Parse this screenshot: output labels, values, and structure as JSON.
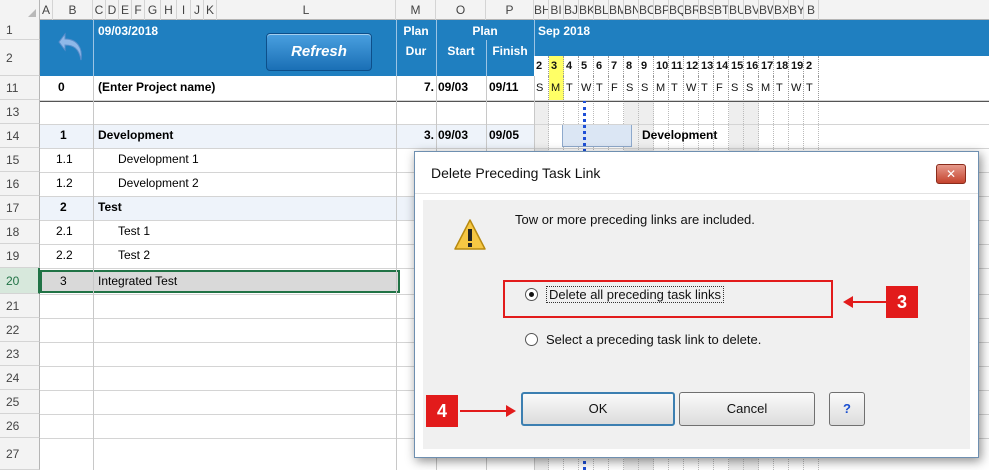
{
  "columns": [
    "A",
    "B",
    "C",
    "D",
    "E",
    "F",
    "G",
    "H",
    "I",
    "J",
    "K",
    "L",
    "M",
    "O",
    "P",
    "BH",
    "BI",
    "BJ",
    "BK",
    "BL",
    "BM",
    "BN",
    "BO",
    "BP",
    "BQ",
    "BR",
    "BS",
    "BT",
    "BU",
    "BV",
    "BW",
    "BX",
    "BY",
    "B"
  ],
  "row_numbers": [
    "1",
    "2",
    "11",
    "13",
    "14",
    "15",
    "16",
    "17",
    "18",
    "19",
    "20",
    "21",
    "22",
    "23",
    "24",
    "25",
    "26",
    "27"
  ],
  "header": {
    "date": "09/03/2018",
    "refresh_label": "Refresh",
    "plan_dur_1": "Plan",
    "plan_dur_2": "Dur",
    "plan_label": "Plan",
    "start_label": "Start",
    "finish_label": "Finish",
    "month": "Sep 2018",
    "days": [
      "2",
      "3",
      "4",
      "5",
      "6",
      "7",
      "8",
      "9",
      "10",
      "11",
      "12",
      "13",
      "14",
      "15",
      "16",
      "17",
      "18",
      "19",
      "2"
    ],
    "weekdays": [
      "S",
      "M",
      "T",
      "W",
      "T",
      "F",
      "S",
      "S",
      "M",
      "T",
      "W",
      "T",
      "F",
      "S",
      "S",
      "M",
      "T",
      "W",
      "T"
    ]
  },
  "project_row": {
    "id": "0",
    "name": "(Enter Project name)",
    "dur": "7.",
    "start": "09/03",
    "finish": "09/11"
  },
  "tasks": [
    {
      "id": "1",
      "name": "Development",
      "bold": true,
      "dur": "3.",
      "start": "09/03",
      "finish": "09/05",
      "gantt_label": "Development"
    },
    {
      "id": "1.1",
      "name": "Development 1",
      "bold": false
    },
    {
      "id": "1.2",
      "name": "Development 2",
      "bold": false
    },
    {
      "id": "2",
      "name": "Test",
      "bold": true
    },
    {
      "id": "2.1",
      "name": "Test 1",
      "bold": false
    },
    {
      "id": "2.2",
      "name": "Test 2",
      "bold": false
    },
    {
      "id": "3",
      "name": "Integrated Test",
      "bold": false
    }
  ],
  "dialog": {
    "title": "Delete Preceding Task Link",
    "close_label": "✕",
    "message": "Tow or more preceding links are included.",
    "option_all": "Delete all preceding task links",
    "option_select": "Select a preceding task link to delete.",
    "ok_label": "OK",
    "cancel_label": "Cancel",
    "help_label": "?"
  },
  "callouts": {
    "step3": "3",
    "step4": "4"
  },
  "colors": {
    "header_blue": "#1f7fc0",
    "callout_red": "#e21b1b",
    "today_yellow": "#ffff66",
    "selected_green": "#217346"
  }
}
